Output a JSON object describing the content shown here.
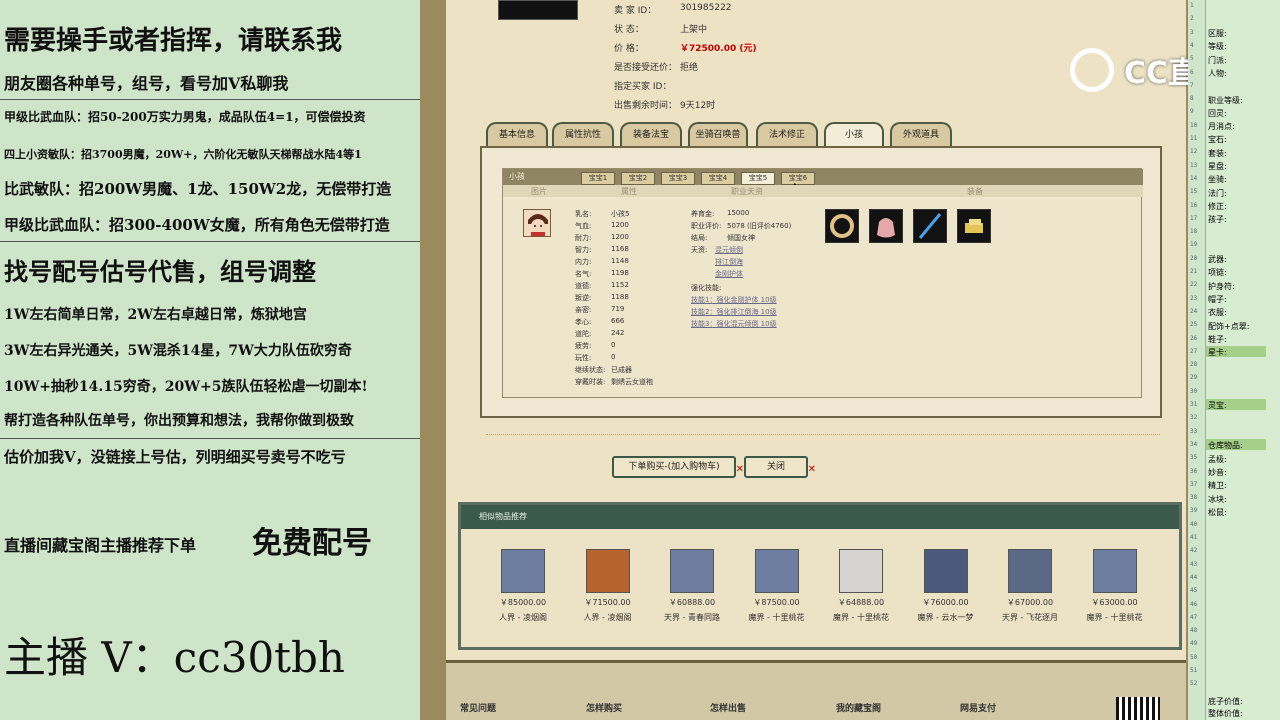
{
  "overlay_left": {
    "lines": [
      "需要操手或者指挥，请联系我",
      "朋友圈各种单号，组号，看号加Ⅴ私聊我",
      "甲级比武血队：招50-200万实力男鬼，成品队伍4=1，可偿偿投资",
      "四上小资敏队：招3700男魔，20W+，六阶化无敏队天梯帮战水陆4等1",
      "比武敏队：招200W男魔、1龙、150W2龙，无偿带打造",
      "甲级比武血队：招300-400W女魔，所有角色无偿带打造",
      "找号配号估号代售，组号调整",
      "1W左右简单日常，2W左右卓越日常，炼狱地宫",
      "3W左右异光通关，5W混杀14星，7W大力队伍砍穷奇",
      "10W+抽秒14.15穷奇，20W+5族队伍轻松虐一切副本!",
      "帮打造各种队伍单号，你出预算和想法，我帮你做到极致",
      "估价加我Ⅴ，没链接上号估，列明细买号卖号不吃亏",
      "直播间藏宝阁主播推荐下单",
      "免费配号",
      "主播 V：cc30tbh"
    ]
  },
  "listing": {
    "seller_label": "卖 家 ID：",
    "seller_value": "301985222",
    "status_label": "状 态：",
    "status_value": "上架中",
    "price_label": "价 格：",
    "price_value": "￥72500.00 (元)",
    "bargain_label": "是否接受还价：",
    "bargain_value": "拒绝",
    "buyer_label": "指定买家 ID：",
    "buyer_value": "",
    "time_label": "出售剩余时间：",
    "time_value": "9天12时"
  },
  "main_tabs": [
    "基本信息",
    "属性抗性",
    "装备法宝",
    "坐骑召唤兽",
    "法术修正",
    "小孩",
    "外观道具"
  ],
  "active_main_tab": "小孩",
  "child_panel": {
    "bar_title": "小孩",
    "sub_tabs": [
      "宝宝1",
      "宝宝2",
      "宝宝3",
      "宝宝4",
      "宝宝5",
      "宝宝6"
    ],
    "active_sub_tab": "宝宝5",
    "column_headers": [
      "图片",
      "属性",
      "职业天资",
      "装备"
    ],
    "attributes": [
      {
        "k": "乳名:",
        "v": "小孩5"
      },
      {
        "k": "气血:",
        "v": "1200"
      },
      {
        "k": "耐力:",
        "v": "1200"
      },
      {
        "k": "智力:",
        "v": "1168"
      },
      {
        "k": "内力:",
        "v": "1148"
      },
      {
        "k": "名气:",
        "v": "1198"
      },
      {
        "k": "道德:",
        "v": "1152"
      },
      {
        "k": "叛逆:",
        "v": "1188"
      },
      {
        "k": "亲密:",
        "v": "719"
      },
      {
        "k": "孝心:",
        "v": "666"
      },
      {
        "k": "道陀:",
        "v": "242"
      },
      {
        "k": "疲劳:",
        "v": "0"
      },
      {
        "k": "玩性:",
        "v": "0"
      },
      {
        "k": "继续状态:",
        "v": "已成器"
      },
      {
        "k": "穿戴时装:",
        "v": "剩绣云女道袍"
      }
    ],
    "talent": {
      "support_label": "养育金:",
      "support_value": "15000",
      "score_label": "职业评价:",
      "score_value": "5078 (旧评价4760)",
      "ending_label": "结局:",
      "ending_value": "倾国女神",
      "skill_label": "天资:",
      "skills": [
        "混元倾倒",
        "排江倒海",
        "金刚护体"
      ],
      "enhance_label": "强化技能:",
      "enhance": [
        "技能1：强化金刚护体 10级",
        "技能2：强化排江倒海 10级",
        "技能3：强化混元倾倒 10级"
      ]
    },
    "equipment_icons": [
      "bracelet-icon",
      "pouch-icon",
      "sword-icon",
      "ingot-icon"
    ]
  },
  "actions": {
    "buy_label": "下单购买-(加入购物车)",
    "close_label": "关闭"
  },
  "recommend": {
    "title": "相似物品推荐",
    "items": [
      {
        "price": "￥85000.00",
        "server": "人界 - 凌烟阁",
        "color": "#6e7ea0"
      },
      {
        "price": "￥71500.00",
        "server": "人界 - 凌烟阁",
        "color": "#b7632e"
      },
      {
        "price": "￥60888.00",
        "server": "天界 - 青春同路",
        "color": "#6e7ea0"
      },
      {
        "price": "￥87500.00",
        "server": "魔界 - 十里桃花",
        "color": "#6e7ea0"
      },
      {
        "price": "￥64888.00",
        "server": "魔界 - 十里桃花",
        "color": "#d6d4d0"
      },
      {
        "price": "￥76000.00",
        "server": "魔界 - 云水一梦",
        "color": "#4b5a7a"
      },
      {
        "price": "￥67000.00",
        "server": "天界 - 飞花逐月",
        "color": "#5a6a86"
      },
      {
        "price": "￥63000.00",
        "server": "魔界 - 十里桃花",
        "color": "#6e7ea0"
      }
    ]
  },
  "footer": [
    "常见问题",
    "怎样购买",
    "怎样出售",
    "我的藏宝阁",
    "网易支付"
  ],
  "watermark": "CC直播",
  "right_panel": {
    "labels": [
      "区服:",
      "等级:",
      "门派:",
      "人物:",
      "职业等级:",
      "回灵:",
      "月消点:",
      "宝石:",
      "套装:",
      "星盘:",
      "坐骑:",
      "法门:",
      "修正:",
      "孩子:",
      "武器:",
      "项链:",
      "护身符:",
      "帽子:",
      "衣服:",
      "配饰+点翠:",
      "鞋子:",
      "星卡:",
      "灵宝:",
      "仓库物品:",
      "孟极:",
      "妙音:",
      "精卫:",
      "冰块:",
      "松鼠:",
      "底子价值:",
      "整体价值:"
    ]
  }
}
